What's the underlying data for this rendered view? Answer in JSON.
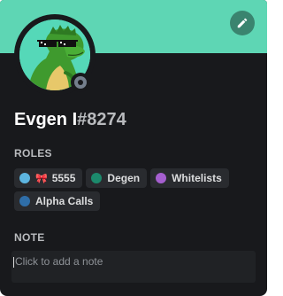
{
  "profile": {
    "username": "Evgen I",
    "discriminator": "#8274",
    "banner_color": "#5ed6b4",
    "status": "offline"
  },
  "roles_section": {
    "title": "ROLES",
    "roles": [
      {
        "label": "5555",
        "color": "#5db5e0",
        "emoji": "🎀"
      },
      {
        "label": "Degen",
        "color": "#1c8a6c"
      },
      {
        "label": "Whitelists",
        "color": "#a55fcf"
      },
      {
        "label": "Alpha Calls",
        "color": "#2f6ea8"
      }
    ]
  },
  "note_section": {
    "title": "NOTE",
    "placeholder": "Click to add a note"
  },
  "icons": {
    "edit": "pencil-icon",
    "status": "offline-status-icon"
  }
}
